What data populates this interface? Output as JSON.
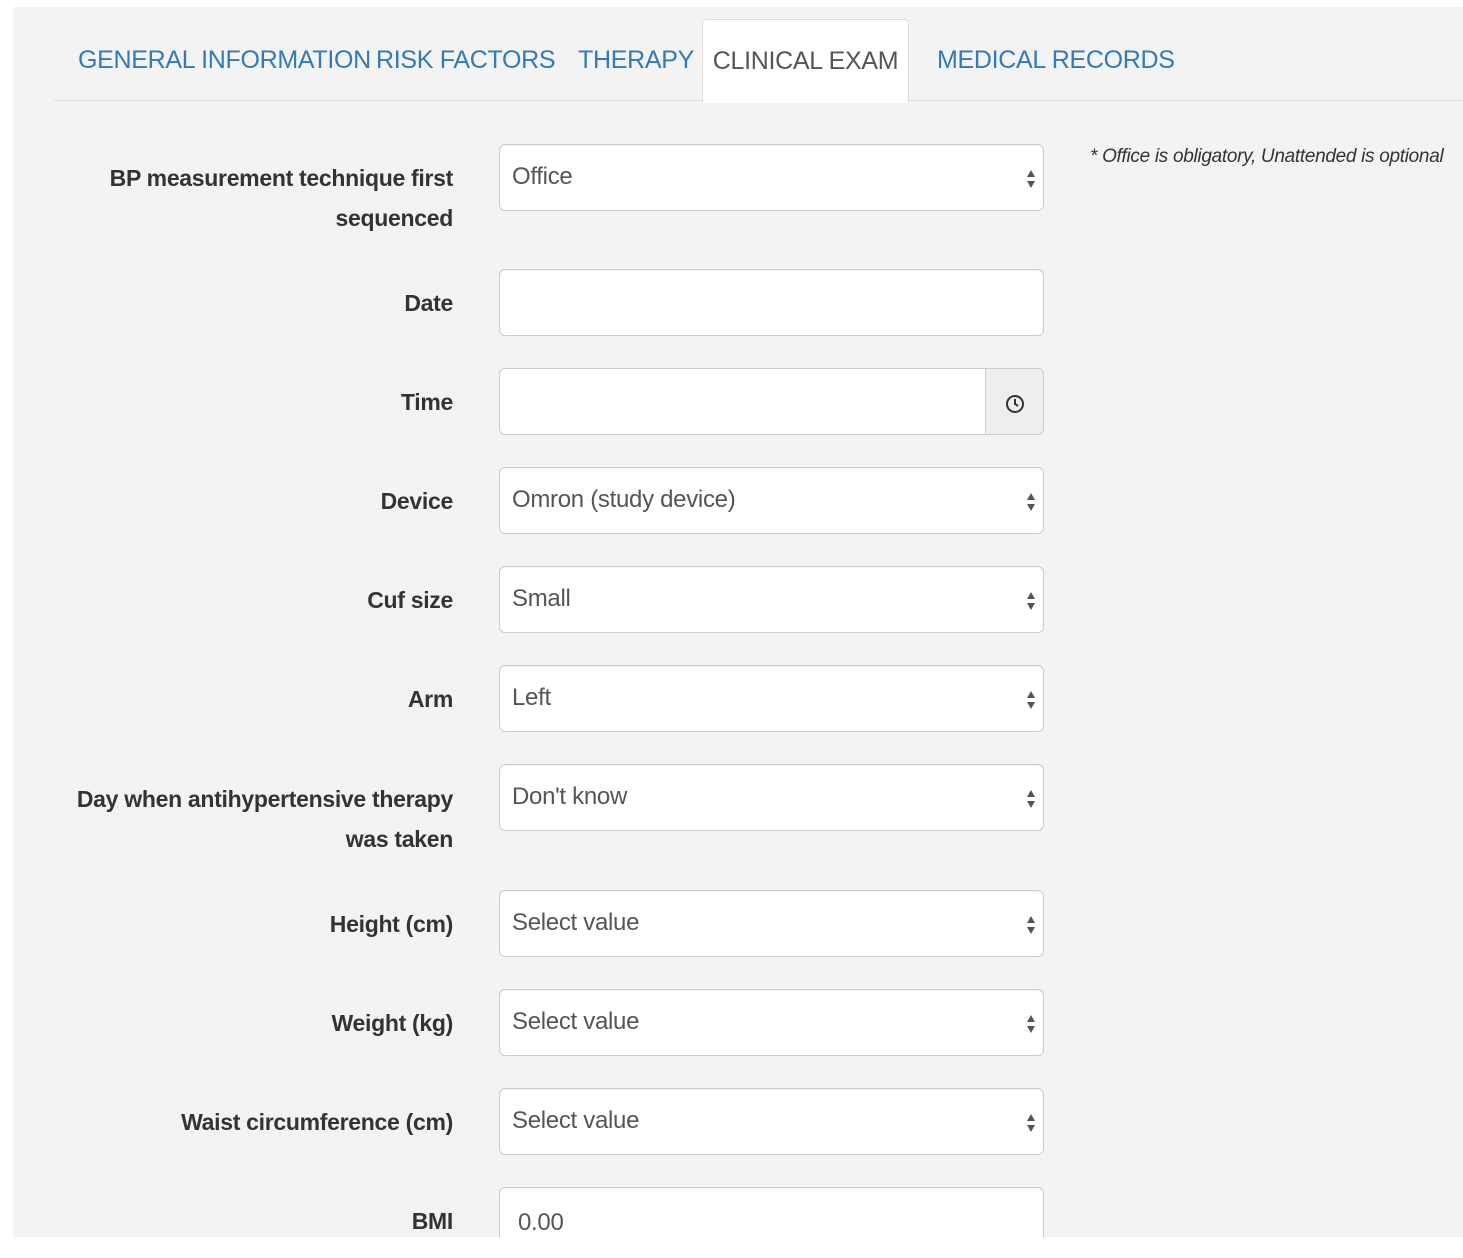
{
  "tabs": [
    {
      "label": "GENERAL INFORMATION",
      "active": false
    },
    {
      "label": "RISK FACTORS",
      "active": false
    },
    {
      "label": "THERAPY",
      "active": false
    },
    {
      "label": "CLINICAL EXAM",
      "active": true
    },
    {
      "label": "MEDICAL RECORDS",
      "active": false
    }
  ],
  "note": "* Office is obligatory, Unattended is optional",
  "fields": {
    "bp_technique": {
      "label_line1": "BP measurement technique first",
      "label_line2": "sequenced",
      "value": "Office"
    },
    "date": {
      "label": "Date",
      "value": ""
    },
    "time": {
      "label": "Time",
      "value": ""
    },
    "device": {
      "label": "Device",
      "value": "Omron (study device)"
    },
    "cuf_size": {
      "label": "Cuf size",
      "value": "Small"
    },
    "arm": {
      "label": "Arm",
      "value": "Left"
    },
    "therapy_day": {
      "label_line1": "Day when antihypertensive therapy",
      "label_line2": "was taken",
      "value": "Don't know"
    },
    "height": {
      "label": "Height (cm)",
      "value": "Select value"
    },
    "weight": {
      "label": "Weight (kg)",
      "value": "Select value"
    },
    "waist": {
      "label": "Waist circumference (cm)",
      "value": "Select value"
    },
    "bmi": {
      "label": "BMI",
      "value": "0.00"
    }
  },
  "colors": {
    "link": "#337ab7",
    "page_bg": "#f3f3f3",
    "border": "#cccccc"
  },
  "icons": {
    "select_arrows": "updown-arrows-icon",
    "time": "clock-icon"
  }
}
